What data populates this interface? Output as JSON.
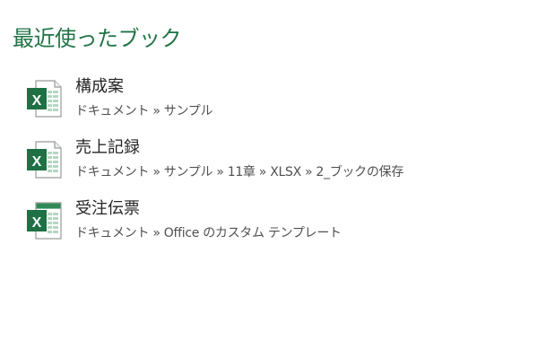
{
  "recent": {
    "title": "最近使ったブック",
    "items": [
      {
        "name": "構成案",
        "path": "ドキュメント » サンプル",
        "icon": "excel-workbook-icon"
      },
      {
        "name": "売上記録",
        "path": "ドキュメント » サンプル » 11章 » XLSX » 2_ブックの保存",
        "icon": "excel-workbook-icon"
      },
      {
        "name": "受注伝票",
        "path": "ドキュメント » Office のカスタム テンプレート",
        "icon": "excel-template-icon"
      }
    ]
  },
  "colors": {
    "accent": "#217346",
    "name_text": "#262626",
    "path_text": "#505050",
    "background": "#ffffff"
  }
}
